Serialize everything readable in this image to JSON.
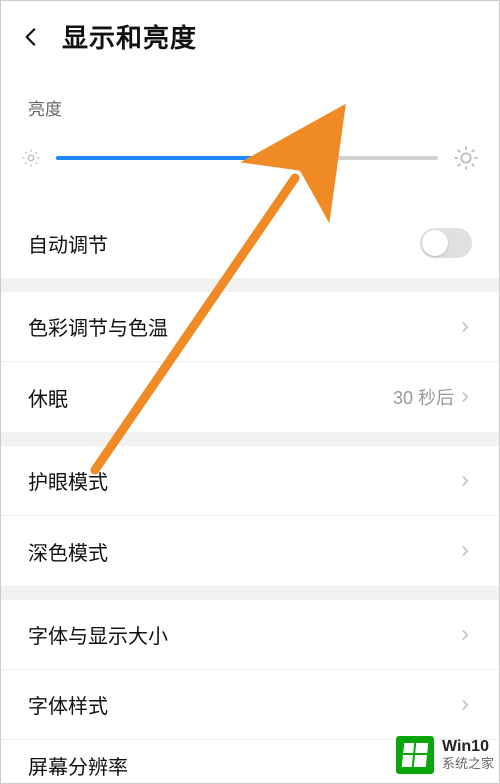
{
  "header": {
    "title": "显示和亮度"
  },
  "brightness": {
    "label": "亮度",
    "value_percent": 66
  },
  "auto_adjust": {
    "label": "自动调节",
    "on": false
  },
  "rows": {
    "color_temp": {
      "label": "色彩调节与色温"
    },
    "sleep": {
      "label": "休眠",
      "value": "30 秒后"
    },
    "eye_comfort": {
      "label": "护眼模式"
    },
    "dark_mode": {
      "label": "深色模式"
    },
    "font_size": {
      "label": "字体与显示大小"
    },
    "font_style": {
      "label": "字体样式"
    },
    "resolution": {
      "label": "屏幕分辨率"
    }
  },
  "watermark": {
    "line1": "Win10",
    "line2": "系统之家"
  },
  "colors": {
    "accent": "#1e88ff",
    "annotation": "#f08a24",
    "logo": "#0aa50a"
  }
}
